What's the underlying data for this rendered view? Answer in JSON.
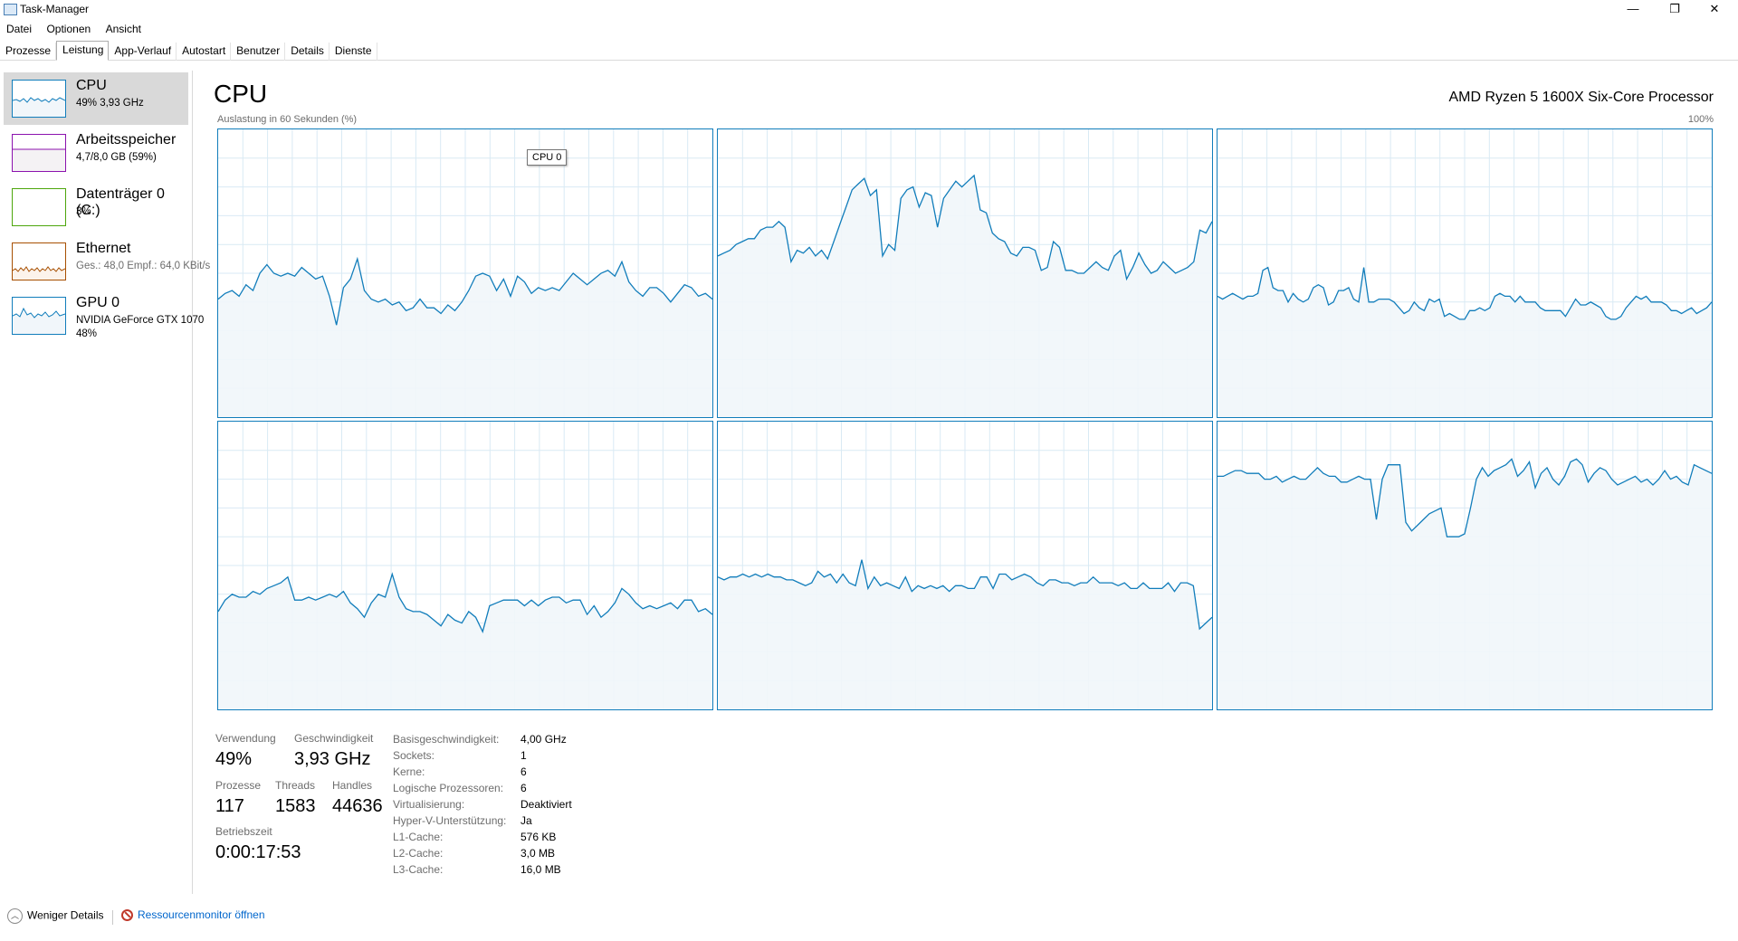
{
  "window": {
    "title": "Task-Manager",
    "minimize": "—",
    "maximize": "❐",
    "close": "✕"
  },
  "menu": [
    "Datei",
    "Optionen",
    "Ansicht"
  ],
  "tabs": [
    "Prozesse",
    "Leistung",
    "App-Verlauf",
    "Autostart",
    "Benutzer",
    "Details",
    "Dienste"
  ],
  "active_tab": "Leistung",
  "sidebar": [
    {
      "title": "CPU",
      "sub": "49% 3,93 GHz",
      "sub2": "",
      "color": "#117dbb",
      "active": true
    },
    {
      "title": "Arbeitsspeicher",
      "sub": "4,7/8,0 GB (59%)",
      "sub2": "",
      "color": "#8b12ae",
      "active": false
    },
    {
      "title": "Datenträger 0 (C:)",
      "sub": "3%",
      "sub2": "",
      "color": "#4da60c",
      "active": false
    },
    {
      "title": "Ethernet",
      "sub": "Ges.: 48,0 Empf.: 64,0 KBit/s",
      "sub2": "",
      "color": "#a74f01",
      "active": false
    },
    {
      "title": "GPU 0",
      "sub": "NVIDIA GeForce GTX 1070",
      "sub2": "48%",
      "color": "#117dbb",
      "active": false
    }
  ],
  "header": {
    "title": "CPU",
    "processor": "AMD Ryzen 5 1600X Six-Core Processor",
    "graph_label": "Auslastung in 60 Sekunden (%)",
    "graph_max": "100%"
  },
  "tooltip": "CPU 0",
  "colors": {
    "graph_line": "#117dbb",
    "graph_fill": "#f1f6fa",
    "grid": "#d9eaf4"
  },
  "chart_data": {
    "type": "line",
    "title": "",
    "ylim": [
      0,
      100
    ],
    "x_range_seconds": 60,
    "series": [
      {
        "values": [
          41,
          43,
          44,
          42,
          46,
          44,
          50,
          53,
          50,
          49,
          50,
          49,
          52,
          50,
          48,
          49,
          42,
          32,
          45,
          48,
          55,
          44,
          41,
          40,
          41,
          39,
          40,
          37,
          38,
          41,
          38,
          38,
          36,
          39,
          37,
          40,
          44,
          49,
          50,
          49,
          44,
          48,
          42,
          49,
          47,
          43,
          45,
          44,
          45,
          44,
          47,
          50,
          48,
          46,
          48,
          50,
          51,
          49,
          54,
          47,
          44,
          42,
          45,
          45,
          43,
          40,
          43,
          46,
          45,
          42,
          43,
          41
        ]
      },
      {
        "values": [
          56,
          57,
          58,
          60,
          61,
          62,
          62,
          65,
          66,
          66,
          68,
          66,
          54,
          58,
          57,
          59,
          56,
          58,
          55,
          61,
          67,
          73,
          79,
          81,
          83,
          77,
          79,
          56,
          60,
          58,
          76,
          79,
          80,
          73,
          78,
          77,
          66,
          76,
          79,
          82,
          80,
          82,
          84,
          72,
          71,
          64,
          62,
          61,
          57,
          56,
          59,
          59,
          58,
          51,
          52,
          61,
          59,
          51,
          51,
          50,
          50,
          52,
          54,
          52,
          51,
          56,
          58,
          48,
          52,
          57,
          53,
          50,
          51,
          54,
          52,
          50,
          51,
          52,
          54,
          65,
          64,
          68
        ]
      },
      {
        "values": [
          42,
          41,
          42,
          43,
          42,
          41,
          42,
          42,
          43,
          51,
          52,
          45,
          44,
          44,
          40,
          43,
          41,
          40,
          41,
          45,
          46,
          45,
          39,
          40,
          44,
          44,
          45,
          41,
          40,
          52,
          40,
          40,
          41,
          41,
          41,
          40,
          38,
          36,
          37,
          40,
          38,
          37,
          41,
          40,
          41,
          35,
          36,
          35,
          34,
          34,
          37,
          37,
          38,
          37,
          38,
          42,
          43,
          42,
          42,
          40,
          42,
          40,
          40,
          40,
          38,
          37,
          37,
          37,
          37,
          35,
          38,
          41,
          39,
          39,
          40,
          39,
          38,
          35,
          34,
          34,
          35,
          38,
          40,
          42,
          41,
          42,
          40,
          40,
          40,
          39,
          37,
          37,
          36,
          37,
          38,
          36,
          37,
          38,
          40
        ]
      },
      {
        "values": [
          34,
          38,
          40,
          39,
          39,
          41,
          40,
          42,
          43,
          44,
          46,
          38,
          38,
          39,
          38,
          39,
          40,
          39,
          41,
          37,
          35,
          32,
          37,
          40,
          39,
          47,
          39,
          35,
          34,
          34,
          33,
          31,
          29,
          33,
          31,
          30,
          34,
          32,
          27,
          36,
          37,
          38,
          38,
          38,
          36,
          38,
          36,
          38,
          39,
          39,
          37,
          38,
          38,
          33,
          36,
          32,
          34,
          37,
          42,
          40,
          37,
          35,
          36,
          35,
          36,
          37,
          35,
          38,
          38,
          34,
          35,
          33
        ]
      },
      {
        "values": [
          46,
          45,
          46,
          46,
          47,
          46,
          47,
          46,
          47,
          46,
          46,
          45,
          45,
          44,
          43,
          44,
          48,
          46,
          47,
          44,
          47,
          44,
          43,
          52,
          42,
          46,
          43,
          44,
          43,
          42,
          46,
          41,
          43,
          42,
          43,
          42,
          43,
          41,
          43,
          43,
          42,
          42,
          46,
          46,
          42,
          47,
          47,
          45,
          46,
          47,
          46,
          44,
          43,
          45,
          45,
          44,
          44,
          43,
          44,
          44,
          46,
          44,
          44,
          44,
          43,
          44,
          42,
          42,
          44,
          42,
          42,
          42,
          44,
          41,
          44,
          44,
          43,
          28,
          30,
          32
        ]
      },
      {
        "values": [
          81,
          81,
          82,
          83,
          83,
          82,
          82,
          82,
          80,
          80,
          81,
          79,
          80,
          81,
          80,
          80,
          82,
          84,
          82,
          81,
          81,
          79,
          79,
          80,
          81,
          80,
          80,
          66,
          80,
          85,
          85,
          85,
          65,
          62,
          64,
          66,
          68,
          69,
          70,
          60,
          60,
          60,
          61,
          70,
          80,
          84,
          81,
          83,
          84,
          85,
          87,
          81,
          83,
          86,
          77,
          82,
          84,
          80,
          78,
          81,
          86,
          87,
          85,
          79,
          82,
          84,
          83,
          80,
          78,
          79,
          80,
          81,
          79,
          80,
          78,
          80,
          83,
          80,
          81,
          79,
          78,
          85,
          84,
          83,
          82
        ]
      }
    ]
  },
  "stats": {
    "verwendung_label": "Verwendung",
    "verwendung": "49%",
    "geschwindigkeit_label": "Geschwindigkeit",
    "geschwindigkeit": "3,93 GHz",
    "prozesse_label": "Prozesse",
    "prozesse": "117",
    "threads_label": "Threads",
    "threads": "1583",
    "handles_label": "Handles",
    "handles": "44636",
    "betriebszeit_label": "Betriebszeit",
    "betriebszeit": "0:00:17:53"
  },
  "details": [
    {
      "key": "Basisgeschwindigkeit:",
      "value": "4,00 GHz"
    },
    {
      "key": "Sockets:",
      "value": "1"
    },
    {
      "key": "Kerne:",
      "value": "6"
    },
    {
      "key": "Logische Prozessoren:",
      "value": "6"
    },
    {
      "key": "Virtualisierung:",
      "value": "Deaktiviert"
    },
    {
      "key": "Hyper-V-Unterstützung:",
      "value": "Ja"
    },
    {
      "key": "L1-Cache:",
      "value": "576 KB"
    },
    {
      "key": "L2-Cache:",
      "value": "3,0 MB"
    },
    {
      "key": "L3-Cache:",
      "value": "16,0 MB"
    }
  ],
  "footer": {
    "less_details": "Weniger Details",
    "resource_monitor": "Ressourcenmonitor öffnen"
  }
}
